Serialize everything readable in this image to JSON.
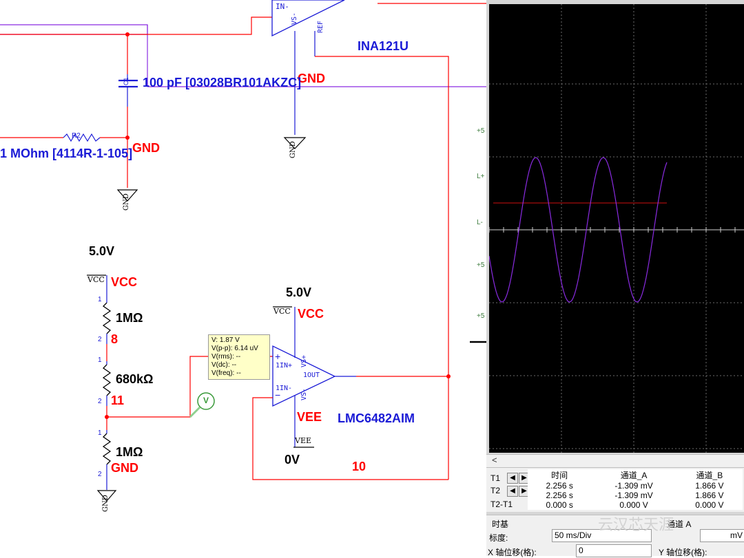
{
  "schematic": {
    "ina_part": "INA121U",
    "ina_pin_in_minus": "IN-",
    "ina_pin_vs_minus": "VS-",
    "ina_pin_ref": "REF",
    "cap_label": "100 pF  [03028BR101AKZC]",
    "cap_ref": "C1",
    "gnd1": "GND",
    "gnd2": "GND",
    "gnd3": "GND",
    "res_top_label": "1 MOhm  [4114R-1-105]",
    "res_top_ref": "R2",
    "gnd_symbol": "GND",
    "vcc_value_left": "5.0V",
    "vcc_symbol": "VCC",
    "vcc_net_left": "VCC",
    "r1_value": "1MΩ",
    "r2_value": "680kΩ",
    "r3_value": "1MΩ",
    "pin1": "1",
    "pin2": "2",
    "node8": "8",
    "node11": "11",
    "gnd_bottom": "GND",
    "vcc_value_right": "5.0V",
    "vcc_net_right": "VCC",
    "opamp_in_plus": "1IN+",
    "opamp_in_minus": "1IN-",
    "opamp_out": "1OUT",
    "opamp_vs_plus": "VS+",
    "opamp_vs_minus": "VS-",
    "plus_sign": "+",
    "minus_sign": "−",
    "vee_net": "VEE",
    "vee_symbol": "VEE",
    "vee_value": "0V",
    "opamp_part": "LMC6482AIM",
    "node10": "10",
    "probe_symbol": "V"
  },
  "probe_tooltip": {
    "v": "V: 1.87 V",
    "vpp": "V(p-p): 6.14 uV",
    "vrms": "V(rms): --",
    "vdc": "V(dc): --",
    "vfreq": "V(freq): --"
  },
  "scope": {
    "side_labels": [
      "+5",
      "L+",
      "L-",
      "+5",
      "+5"
    ],
    "scroll_label": "<",
    "t1_label": "T1",
    "t2_label": "T2",
    "t2t1_label": "T2-T1",
    "headers": [
      "时间",
      "通道_A",
      "通道_B"
    ],
    "rows": [
      [
        "2.256 s",
        "-1.309 mV",
        "1.866 V"
      ],
      [
        "2.256 s",
        "-1.309 mV",
        "1.866 V"
      ],
      [
        "0.000 s",
        "0.000 V",
        "0.000 V"
      ]
    ],
    "timebase_label": "时基",
    "channel_a_label": "通道 A",
    "scale_label": "标度:",
    "scale_value": "50 ms/Div",
    "channel_scale_value": "mV",
    "xpos_label": "X 轴位移(格):",
    "xpos_value": "0",
    "ypos_label": "Y 轴位移(格):"
  },
  "colors": {
    "wire_red": "#ff0000",
    "wire_purple": "#8a2be2",
    "net_blue": "#1a1ad6",
    "trace_a": "#8a2be2",
    "trace_b": "#d01010"
  },
  "watermark": "云汉芯天涯"
}
